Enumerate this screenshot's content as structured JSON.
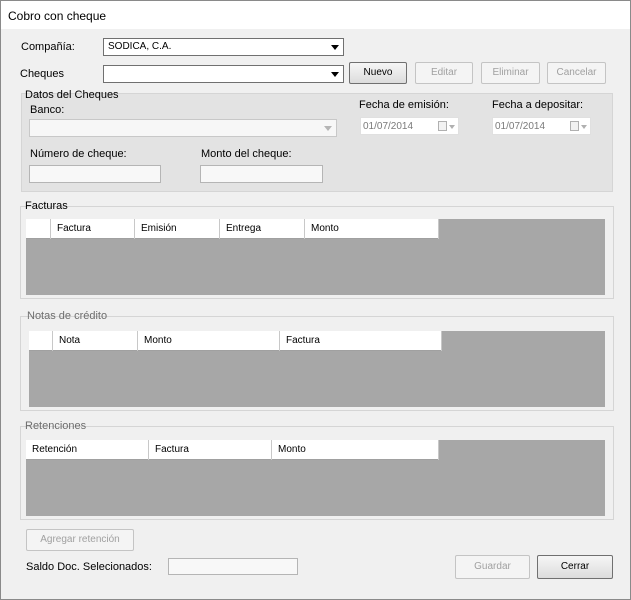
{
  "window": {
    "title": "Cobro con cheque"
  },
  "top": {
    "company_label": "Compañía:",
    "company_value": "SODICA, C.A.",
    "cheques_label": "Cheques",
    "cheques_value": "",
    "buttons": {
      "nuevo": "Nuevo",
      "editar": "Editar",
      "eliminar": "Eliminar",
      "cancelar": "Cancelar"
    }
  },
  "datos": {
    "group_label": "Datos del Cheques",
    "banco_label": "Banco:",
    "banco_value": "",
    "fecha_emision_label": "Fecha de emisión:",
    "fecha_emision_value": "01/07/2014",
    "fecha_depositar_label": "Fecha a depositar:",
    "fecha_depositar_value": "01/07/2014",
    "numero_label": "Número de cheque:",
    "numero_value": "",
    "monto_label": "Monto del cheque:",
    "monto_value": ""
  },
  "facturas": {
    "group_label": "Facturas",
    "columns": [
      "",
      "Factura",
      "Emisión",
      "Entrega",
      "Monto"
    ]
  },
  "notas": {
    "group_label": "Notas de crédito",
    "columns": [
      "",
      "Nota",
      "Monto",
      "Factura"
    ]
  },
  "retenciones": {
    "group_label": "Retenciones",
    "columns": [
      "Retención",
      "Factura",
      "Monto"
    ]
  },
  "footer": {
    "agregar_label": "Agregar retención",
    "saldo_label": "Saldo Doc. Selecionados:",
    "saldo_value": "",
    "guardar_label": "Guardar",
    "cerrar_label": "Cerrar"
  }
}
